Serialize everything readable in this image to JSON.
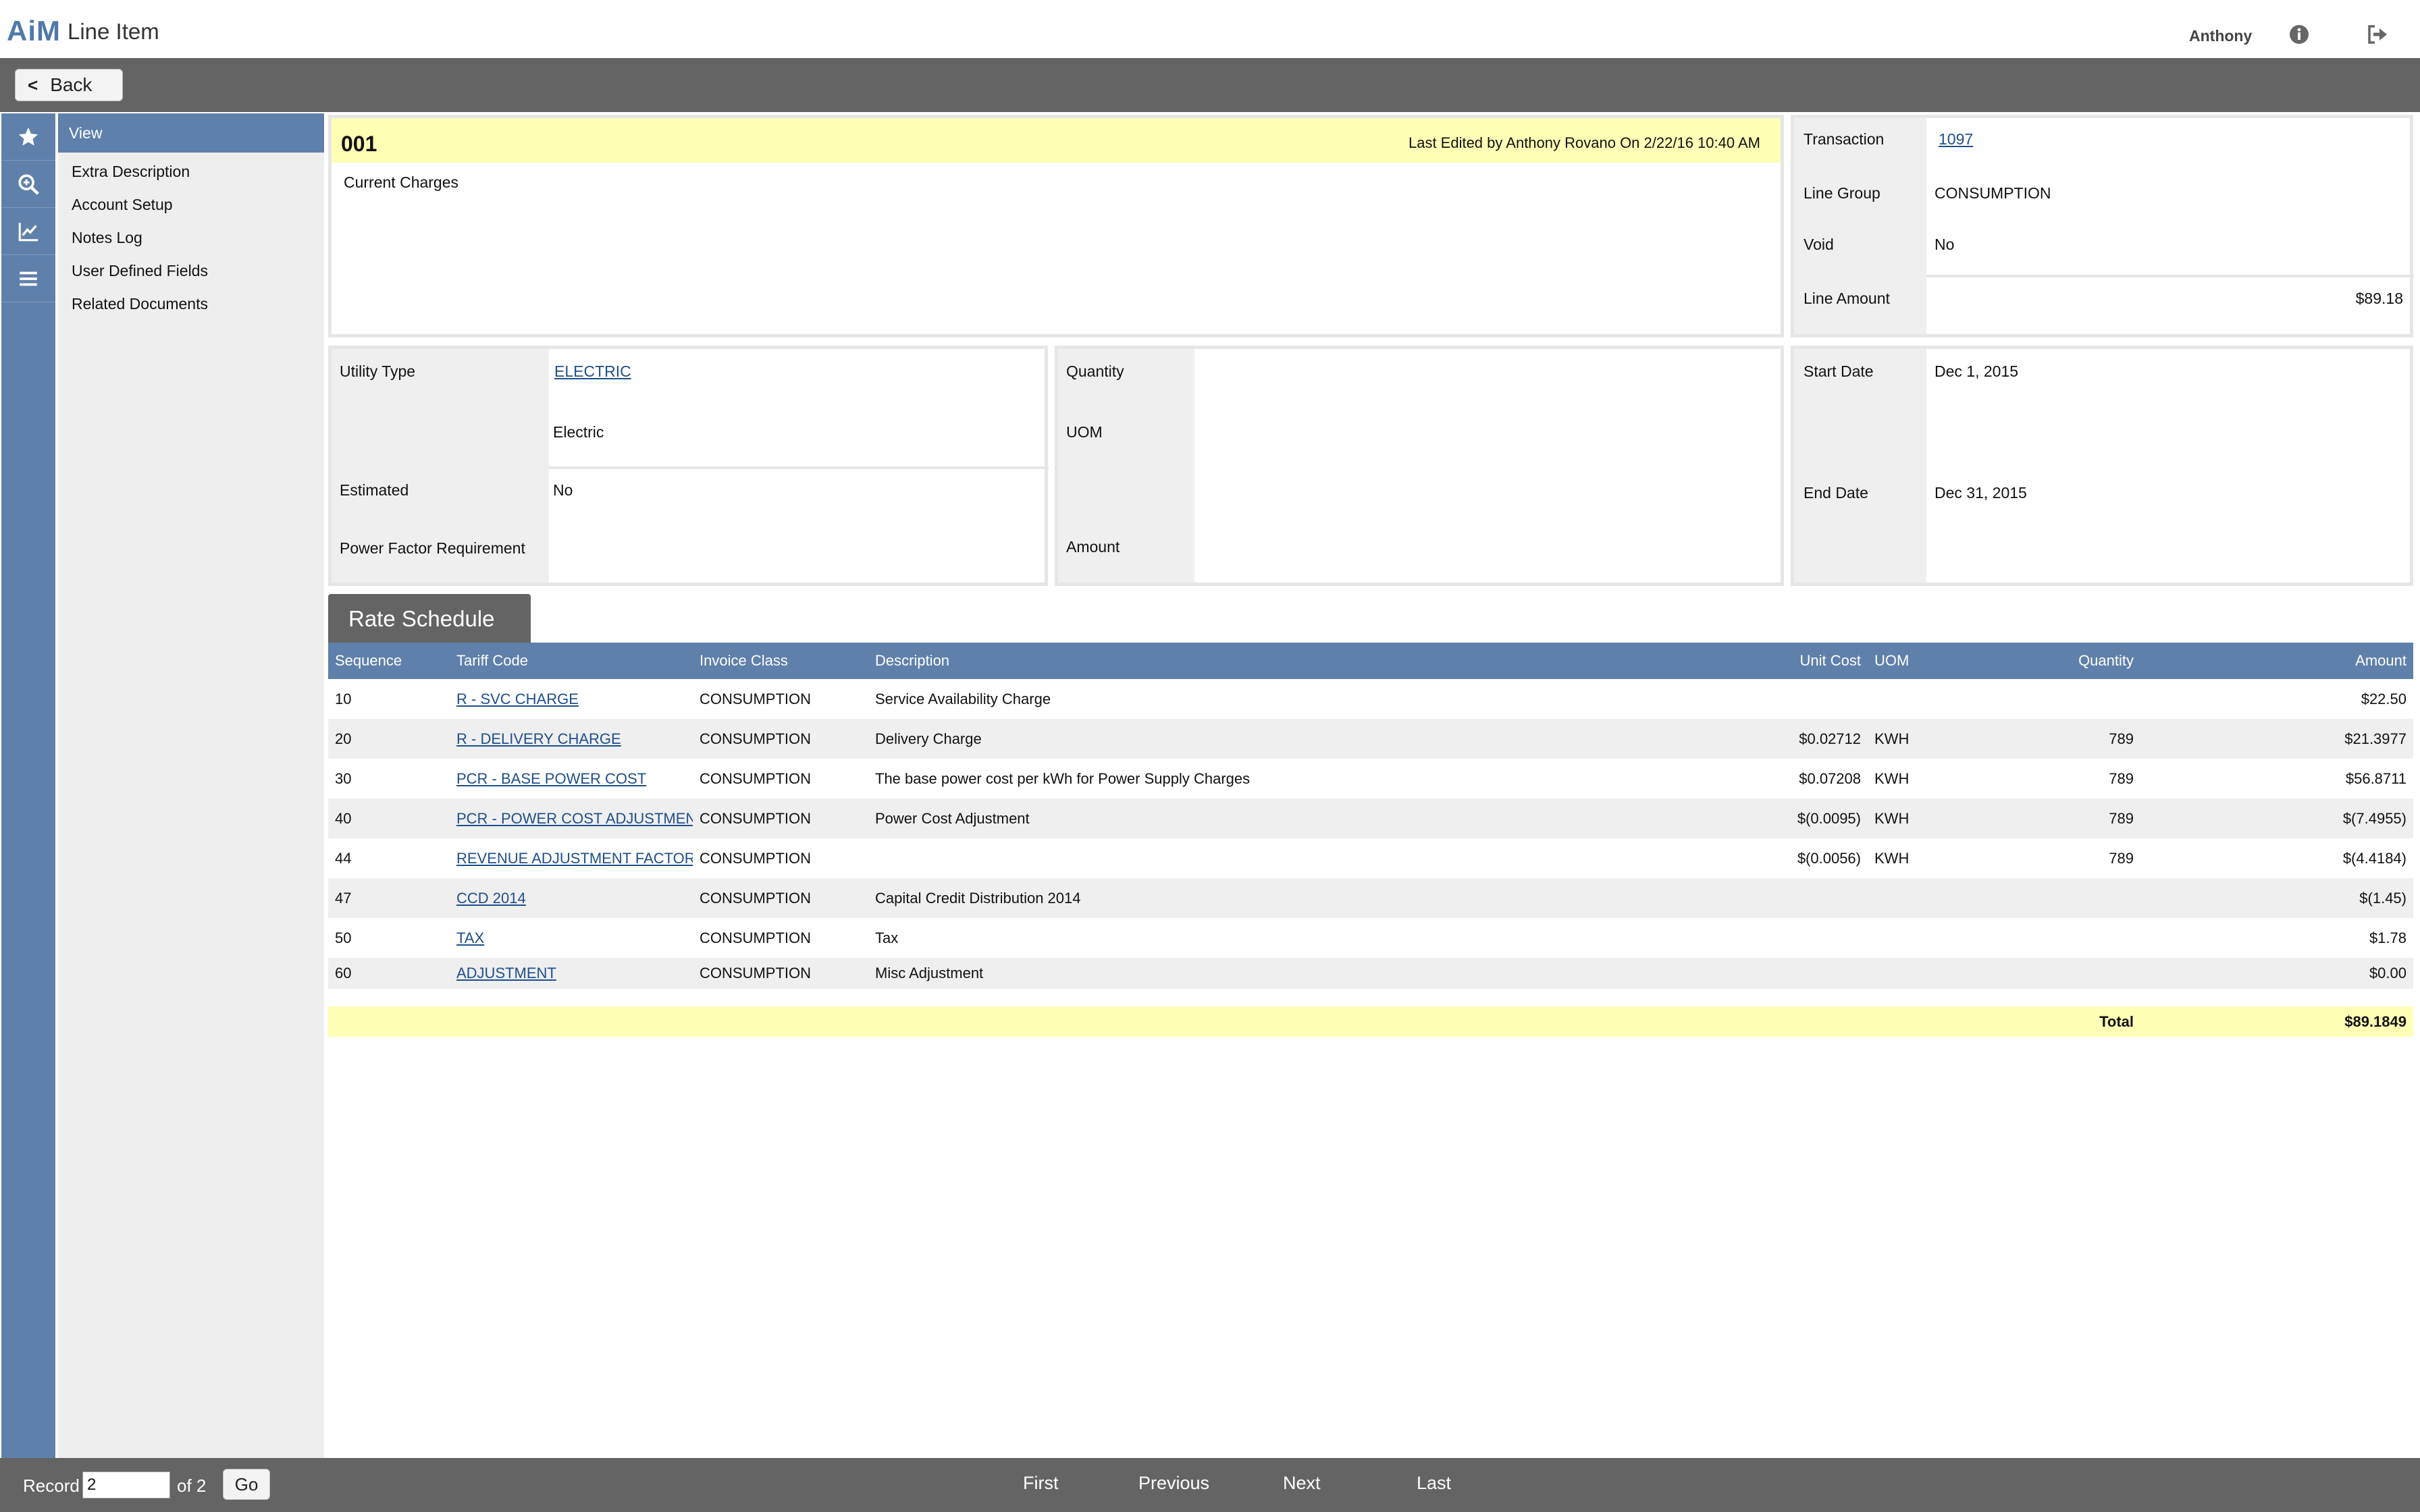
{
  "app": {
    "logo": "AiM",
    "title": "Line Item",
    "user": "Anthony"
  },
  "nav": {
    "back_label": "Back"
  },
  "submenu": {
    "header": "View",
    "items": [
      "Extra Description",
      "Account Setup",
      "Notes Log",
      "User Defined Fields",
      "Related Documents"
    ]
  },
  "line": {
    "code": "001",
    "last_edited": "Last Edited by Anthony Rovano On 2/22/16 10:40 AM",
    "description": "Current Charges"
  },
  "summary": {
    "transaction_label": "Transaction",
    "transaction": "1097",
    "line_group_label": "Line Group",
    "line_group": "CONSUMPTION",
    "void_label": "Void",
    "void": "No",
    "line_amount_label": "Line Amount",
    "line_amount": "$89.18"
  },
  "utility": {
    "type_label": "Utility Type",
    "type_code": "ELECTRIC",
    "type_desc": "Electric",
    "estimated_label": "Estimated",
    "estimated": "No",
    "pfr_label": "Power Factor Requirement",
    "pfr": ""
  },
  "quantity": {
    "quantity_label": "Quantity",
    "quantity": "",
    "uom_label": "UOM",
    "uom": "",
    "amount_label": "Amount",
    "amount": ""
  },
  "dates": {
    "start_label": "Start Date",
    "start": "Dec 1, 2015",
    "end_label": "End Date",
    "end": "Dec 31, 2015"
  },
  "rate_schedule": {
    "tab_label": "Rate Schedule",
    "columns": [
      "Sequence",
      "Tariff Code",
      "Invoice Class",
      "Description",
      "Unit Cost",
      "UOM",
      "Quantity",
      "Amount"
    ],
    "rows": [
      {
        "sequence": "10",
        "tariff": "R - SVC CHARGE",
        "class": "CONSUMPTION",
        "description": "Service Availability Charge",
        "unit_cost": "",
        "uom": "",
        "quantity": "",
        "amount": "$22.50"
      },
      {
        "sequence": "20",
        "tariff": "R - DELIVERY CHARGE",
        "class": "CONSUMPTION",
        "description": "Delivery Charge",
        "unit_cost": "$0.02712",
        "uom": "KWH",
        "quantity": "789",
        "amount": "$21.3977"
      },
      {
        "sequence": "30",
        "tariff": "PCR - BASE POWER COST",
        "class": "CONSUMPTION",
        "description": "The base power cost per kWh for Power Supply Charges",
        "unit_cost": "$0.07208",
        "uom": "KWH",
        "quantity": "789",
        "amount": "$56.8711"
      },
      {
        "sequence": "40",
        "tariff": "PCR - POWER COST ADJUSTMENT",
        "class": "CONSUMPTION",
        "description": "Power Cost Adjustment",
        "unit_cost": "$(0.0095)",
        "uom": "KWH",
        "quantity": "789",
        "amount": "$(7.4955)"
      },
      {
        "sequence": "44",
        "tariff": "REVENUE ADJUSTMENT FACTOR",
        "class": "CONSUMPTION",
        "description": "",
        "unit_cost": "$(0.0056)",
        "uom": "KWH",
        "quantity": "789",
        "amount": "$(4.4184)"
      },
      {
        "sequence": "47",
        "tariff": "CCD 2014",
        "class": "CONSUMPTION",
        "description": "Capital Credit Distribution 2014",
        "unit_cost": "",
        "uom": "",
        "quantity": "",
        "amount": "$(1.45)"
      },
      {
        "sequence": "50",
        "tariff": "TAX",
        "class": "CONSUMPTION",
        "description": "Tax",
        "unit_cost": "",
        "uom": "",
        "quantity": "",
        "amount": "$1.78"
      },
      {
        "sequence": "60",
        "tariff": "ADJUSTMENT",
        "class": "CONSUMPTION",
        "description": "Misc Adjustment",
        "unit_cost": "",
        "uom": "",
        "quantity": "",
        "amount": "$0.00"
      }
    ],
    "total_label": "Total",
    "total": "$89.1849"
  },
  "footer": {
    "record_label": "Record",
    "record_value": "2",
    "of_label": "of 2",
    "go_label": "Go",
    "first": "First",
    "previous": "Previous",
    "next": "Next",
    "last": "Last"
  },
  "icons": [
    "star-icon",
    "zoom-icon",
    "chart-icon",
    "menu-icon",
    "info-icon",
    "logout-icon",
    "chevron-left-icon"
  ],
  "colors": {
    "accent": "#5f80aa",
    "bar": "#646464",
    "highlight": "#ffffb6"
  }
}
